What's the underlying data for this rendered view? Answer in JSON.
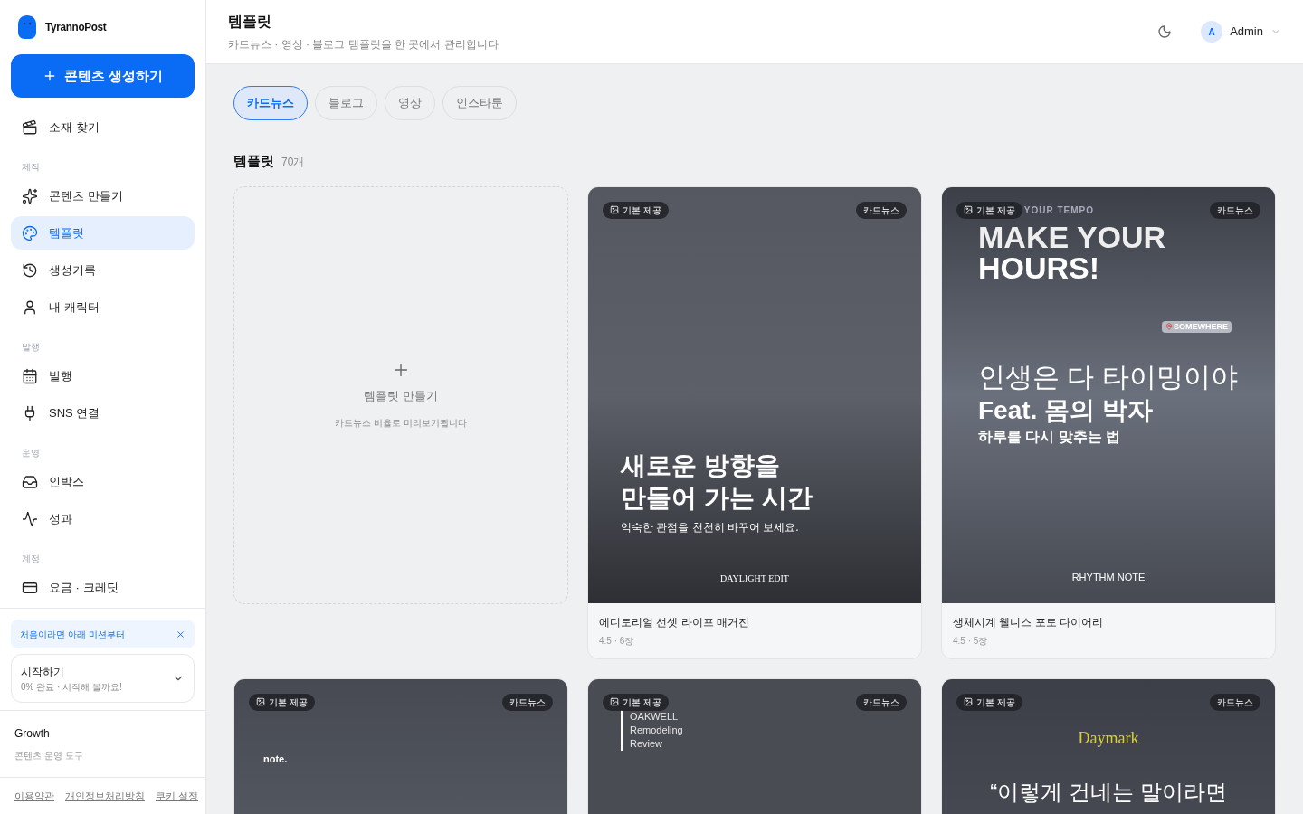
{
  "brand": {
    "name": "TyrannoPost"
  },
  "create_button": {
    "label": "콘텐츠 생성하기"
  },
  "nav": [
    {
      "kind": "item",
      "label": "소재 찾기",
      "selected": false
    },
    {
      "kind": "section",
      "label": "제작"
    },
    {
      "kind": "item",
      "label": "콘텐츠 만들기",
      "selected": false
    },
    {
      "kind": "item",
      "label": "템플릿",
      "selected": true
    },
    {
      "kind": "item",
      "label": "생성기록",
      "selected": false
    },
    {
      "kind": "item",
      "label": "내 캐릭터",
      "selected": false
    },
    {
      "kind": "section",
      "label": "발행"
    },
    {
      "kind": "item",
      "label": "발행",
      "selected": false
    },
    {
      "kind": "item",
      "label": "SNS 연결",
      "selected": false
    },
    {
      "kind": "section",
      "label": "운영"
    },
    {
      "kind": "item",
      "label": "인박스",
      "selected": false
    },
    {
      "kind": "item",
      "label": "성과",
      "selected": false
    },
    {
      "kind": "section",
      "label": "계정"
    },
    {
      "kind": "item",
      "label": "요금 · 크레딧",
      "selected": false
    }
  ],
  "mission_banner": {
    "text": "처음이라면 아래 미션부터"
  },
  "onboarding": {
    "title": "시작하기",
    "subtitle": "0% 완료 · 시작해 볼까요!",
    "expanded": false
  },
  "plan": {
    "name": "Growth",
    "description": "콘텐츠 운영 도구"
  },
  "footer_links": [
    "이용약관",
    "개인정보처리방침",
    "쿠키 설정"
  ],
  "header": {
    "title": "템플릿",
    "subtitle": "카드뉴스 · 영상 · 블로그 템플릿을 한 곳에서 관리합니다",
    "user": {
      "initial": "A",
      "name": "Admin"
    }
  },
  "tabs": [
    {
      "label": "카드뉴스",
      "selected": true
    },
    {
      "label": "블로그",
      "selected": false
    },
    {
      "label": "영상",
      "selected": false
    },
    {
      "label": "인스타툰",
      "selected": false
    }
  ],
  "section": {
    "title": "템플릿",
    "count": "70개"
  },
  "create_card": {
    "title": "템플릿 만들기",
    "hint": "카드뉴스 비율로 미리보기됩니다"
  },
  "templates": [
    {
      "badge": "기본 제공",
      "category": "카드뉴스",
      "title": "에디토리얼 선셋 라이프 매거진",
      "meta": "4:5 · 6장",
      "preview": {
        "kind": "editorial",
        "texts": [
          "새로운 방향을",
          "만들어 가는 시간",
          "익숙한 관점을 천천히 바꾸어 보세요.",
          "DAYLIGHT EDIT"
        ]
      }
    },
    {
      "badge": "기본 제공",
      "category": "카드뉴스",
      "title": "생체시계 웰니스 포토 다이어리",
      "meta": "4:5 · 5장",
      "preview": {
        "kind": "tempo",
        "texts": [
          "YOUR TEMPO",
          "MAKE YOUR",
          "HOURS!",
          "SOMEWHERE",
          "인생은 다 타이밍이야",
          "Feat. 몸의 박자",
          "하루를 다시 맞추는 법",
          "RHYTHM NOTE"
        ]
      }
    },
    {
      "badge": "기본 제공",
      "category": "카드뉴스",
      "preview": {
        "kind": "note",
        "texts": [
          "note."
        ]
      }
    },
    {
      "badge": "기본 제공",
      "category": "카드뉴스",
      "preview": {
        "kind": "oakwell",
        "texts": [
          "OAKWELL",
          "Remodeling",
          "Review"
        ]
      }
    },
    {
      "badge": "기본 제공",
      "category": "카드뉴스",
      "preview": {
        "kind": "daymark",
        "texts": [
          "Daymark",
          "“이렇게 건네는 말이라면"
        ]
      }
    }
  ]
}
